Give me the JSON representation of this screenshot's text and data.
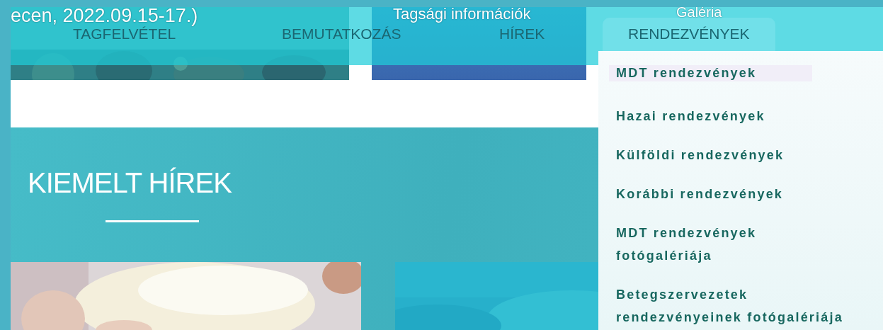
{
  "background_texts": [
    {
      "text": "ecen, 2022.09.15-17.)"
    },
    {
      "text": "Tagsági információk"
    },
    {
      "text": "Galéria"
    }
  ],
  "nav": {
    "items": [
      {
        "label": "TAGFELVÉTEL",
        "selected": false
      },
      {
        "label": "BEMUTATKOZÁS",
        "selected": false
      },
      {
        "label": "HÍREK",
        "selected": false
      },
      {
        "label": "RENDEZVÉNYEK",
        "selected": true
      }
    ]
  },
  "dropdown": {
    "items": [
      {
        "label": "MDT rendezvények",
        "selected": true
      },
      {
        "label": "Hazai rendezvények",
        "selected": false
      },
      {
        "label": "Külföldi rendezvények",
        "selected": false
      },
      {
        "label": "Korábbi rendezvények",
        "selected": false
      },
      {
        "label": "MDT rendezvények fotógalériája",
        "selected": false
      },
      {
        "label": "Betegszervezetek rendezvényeinek fotógalériája",
        "selected": false
      }
    ]
  },
  "section": {
    "title": "KIEMELT HÍREK"
  }
}
